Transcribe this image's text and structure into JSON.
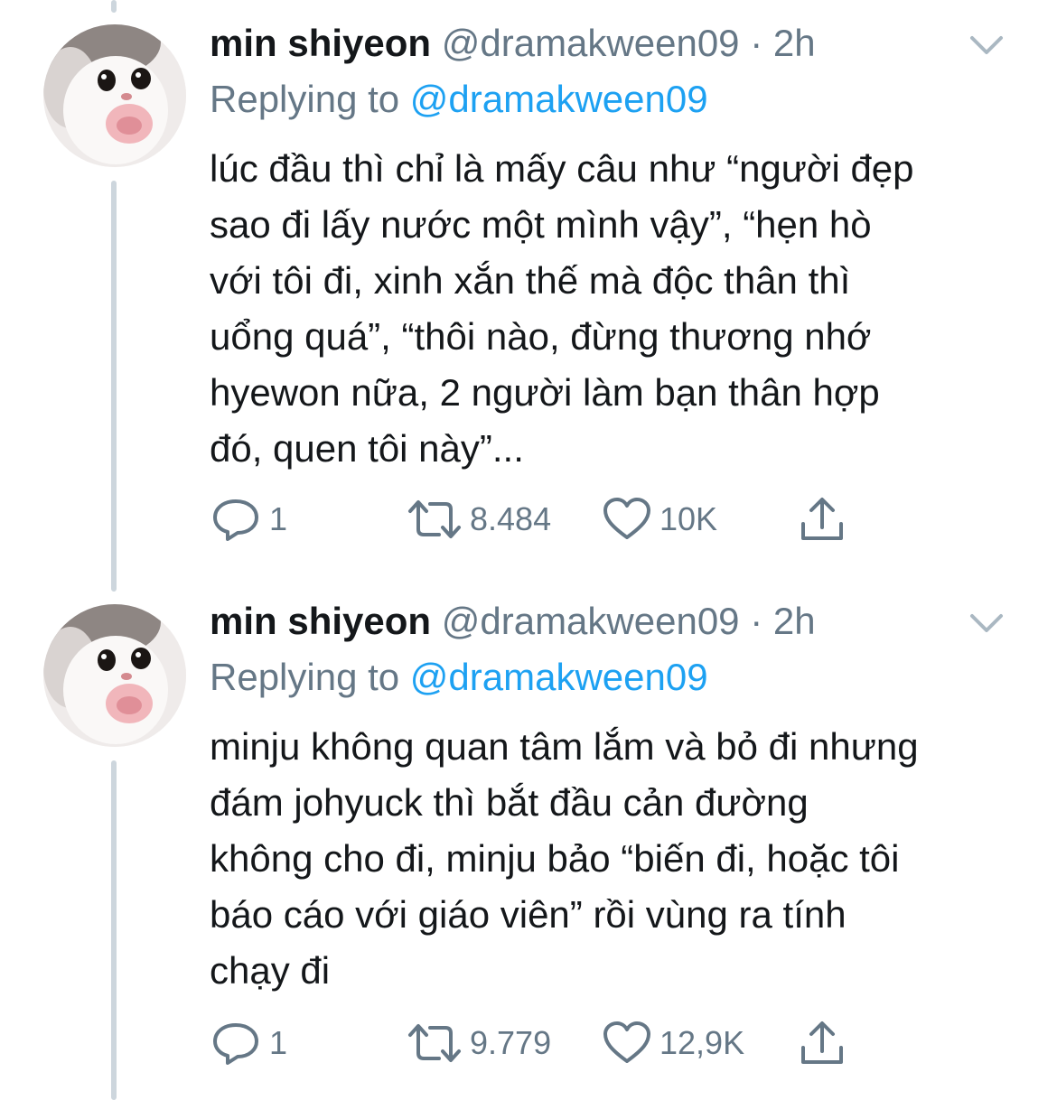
{
  "tweets": [
    {
      "author_name": "min shiyeon",
      "author_handle": "@dramakween09",
      "separator": "·",
      "time": "2h",
      "replying_prefix": "Replying to",
      "replying_handle": "@dramakween09",
      "lines": [
        "lúc đầu thì chỉ là mấy câu như “người đẹp",
        "sao đi lấy nước một mình vậy”, “hẹn hò",
        "với tôi đi, xinh xắn thế mà độc thân thì",
        "uổng quá”, “thôi nào, đừng thương nhớ",
        "hyewon nữa, 2 người làm bạn thân hợp",
        "đó, quen tôi này”..."
      ],
      "replies": "1",
      "retweets": "8.484",
      "likes": "10K"
    },
    {
      "author_name": "min shiyeon",
      "author_handle": "@dramakween09",
      "separator": "·",
      "time": "2h",
      "replying_prefix": "Replying to",
      "replying_handle": "@dramakween09",
      "lines": [
        "minju không quan tâm lắm và bỏ đi nhưng",
        "đám johyuck thì bắt đầu cản đường",
        "không cho đi, minju bảo “biến đi, hoặc tôi",
        "báo cáo với giáo viên” rồi vùng ra tính",
        "chạy đi"
      ],
      "replies": "1",
      "retweets": "9.779",
      "likes": "12,9K"
    }
  ],
  "icons": {
    "reply": "reply-icon",
    "retweet": "retweet-icon",
    "like": "heart-icon",
    "share": "share-icon",
    "more": "chevron-down-icon"
  },
  "colors": {
    "text": "#14171a",
    "secondary": "#657786",
    "link": "#1da1f2",
    "thread_line": "#cdd6dd"
  }
}
